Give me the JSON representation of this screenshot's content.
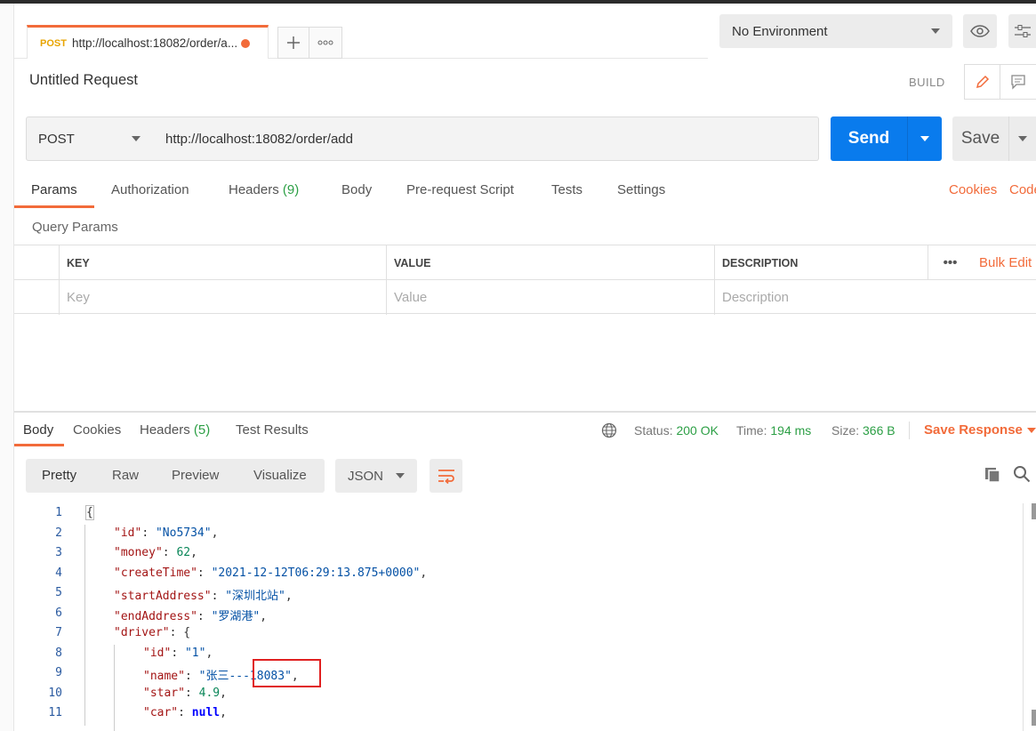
{
  "tab": {
    "method": "POST",
    "url": "http://localhost:18082/order/a..."
  },
  "environment": {
    "selected": "No Environment"
  },
  "request": {
    "title": "Untitled Request",
    "build_label": "BUILD",
    "method": "POST",
    "url": "http://localhost:18082/order/add",
    "send_label": "Send",
    "save_label": "Save"
  },
  "request_tabs": {
    "params": "Params",
    "authorization": "Authorization",
    "headers": "Headers",
    "headers_count": "(9)",
    "body": "Body",
    "prerequest": "Pre-request Script",
    "tests": "Tests",
    "settings": "Settings",
    "cookies": "Cookies",
    "code": "Code"
  },
  "query_params": {
    "label": "Query Params",
    "columns": {
      "key": "KEY",
      "value": "VALUE",
      "description": "DESCRIPTION"
    },
    "more": "•••",
    "bulk_edit": "Bulk Edit",
    "placeholders": {
      "key": "Key",
      "value": "Value",
      "description": "Description"
    }
  },
  "response_tabs": {
    "body": "Body",
    "cookies": "Cookies",
    "headers": "Headers",
    "headers_count": "(5)",
    "test_results": "Test Results"
  },
  "response_status": {
    "status_label": "Status:",
    "status_value": "200 OK",
    "time_label": "Time:",
    "time_value": "194 ms",
    "size_label": "Size:",
    "size_value": "366 B",
    "save_response": "Save Response"
  },
  "format": {
    "pretty": "Pretty",
    "raw": "Raw",
    "preview": "Preview",
    "visualize": "Visualize",
    "language": "JSON"
  },
  "code_lines": {
    "n1": "1",
    "n2": "2",
    "n3": "3",
    "n4": "4",
    "n5": "5",
    "n6": "6",
    "n7": "7",
    "n8": "8",
    "n9": "9",
    "n10": "10",
    "n11": "11",
    "brace_open": "{",
    "k_id": "\"id\"",
    "v_id": "\"No5734\"",
    "k_money": "\"money\"",
    "v_money": "62",
    "k_createTime": "\"createTime\"",
    "v_createTime": "\"2021-12-12T06:29:13.875+0000\"",
    "k_startAddress": "\"startAddress\"",
    "v_startAddress": "\"深圳北站\"",
    "k_endAddress": "\"endAddress\"",
    "v_endAddress": "\"罗湖港\"",
    "k_driver": "\"driver\"",
    "k_driver_id": "\"id\"",
    "v_driver_id": "\"1\"",
    "k_name": "\"name\"",
    "v_name": "\"张三---18083\"",
    "k_star": "\"star\"",
    "v_star": "4.9",
    "k_car": "\"car\"",
    "v_car": "null"
  }
}
